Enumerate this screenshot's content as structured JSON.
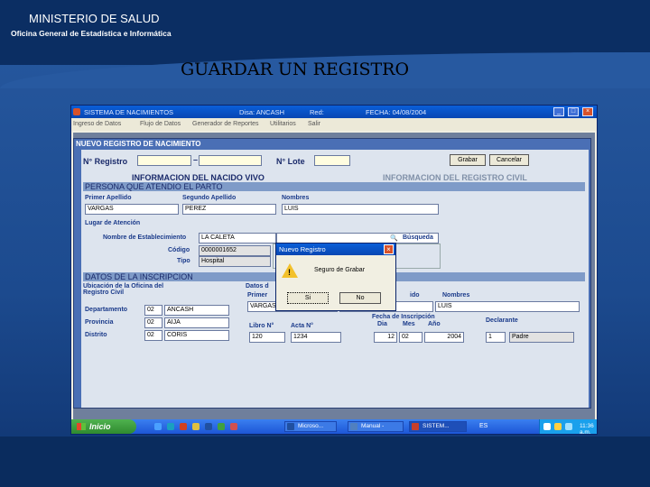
{
  "slide": {
    "org_name": "MINISTERIO DE SALUD",
    "org_office": "Oficina General de Estadística e Informática",
    "title": "GUARDAR UN REGISTRO"
  },
  "window": {
    "title": "SISTEMA DE NACIMIENTOS",
    "disa": "Disa: ANCASH",
    "red": "Red:",
    "fecha": "FECHA: 04/08/2004",
    "min": "_",
    "max": "□",
    "close": "×"
  },
  "menu": [
    "Ingreso de Datos",
    "Flujo de Datos",
    "Generador de Reportes",
    "Utilitarios",
    "Salir"
  ],
  "form": {
    "title": "NUEVO REGISTRO DE NACIMIENTO",
    "nro_registro_label": "N° Registro",
    "nro_lote_label": "N° Lote",
    "grabar": "Grabar",
    "cancelar": "Cancelar",
    "tab_nacido": "INFORMACION DEL NACIDO VIVO",
    "tab_registro": "INFORMACION DEL REGISTRO CIVIL",
    "sec_persona": "PERSONA QUE ATENDIO EL PARTO",
    "primer_apellido_label": "Primer Apellido",
    "segundo_apellido_label": "Segundo Apellido",
    "nombres_label": "Nombres",
    "primer_apellido": "VARGAS",
    "segundo_apellido": "PEREZ",
    "nombres": "LUIS",
    "lugar_label": "Lugar de Atención",
    "establecimiento_label": "Nombre de Establecimiento",
    "establecimiento": "LA CALETA",
    "codigo_label": "Código",
    "codigo": "0000001652",
    "tipo_label": "Tipo",
    "tipo": "Hospital",
    "busqueda": "Búsqueda",
    "sec_inscripcion": "DATOS DE LA INSCRIPCION",
    "ubicacion_label": "Ubicación de la Oficina del Registro Civil",
    "datos_label": "Datos d",
    "primer_label_2": "Primer",
    "nombres_label_2": "Nombres",
    "id_label_2": "ido",
    "departamento_label": "Departamento",
    "provincia_label": "Provincia",
    "distrito_label": "Distrito",
    "dep_code": "02",
    "dep_name": "ANCASH",
    "prov_code": "02",
    "prov_name": "AIJA",
    "dist_code": "02",
    "dist_name": "CORIS",
    "libro_label": "Libro N°",
    "acta_label": "Acta N°",
    "libro": "120",
    "acta": "1234",
    "fecha_insc_label": "Fecha de Inscripción",
    "dia_label": "Dia",
    "mes_label": "Mes",
    "anio_label": "Año",
    "dia": "12",
    "mes": "02",
    "anio": "2004",
    "declarante_label": "Declarante",
    "declarante_code": "1",
    "declarante": "Padre",
    "dec_apellido1": "VARGAS",
    "dec_apellido2": "PEREZ",
    "dec_nombres": "LUIS"
  },
  "dialog": {
    "title": "Nuevo Registro",
    "message": "Seguro de Grabar",
    "yes": "Si",
    "no": "No",
    "close": "×"
  },
  "taskbar": {
    "start": "Inicio",
    "tasks": [
      "Microso...",
      "Manual -",
      "SISTEM..."
    ],
    "lang": "ES",
    "time": "11:36 a.m."
  }
}
